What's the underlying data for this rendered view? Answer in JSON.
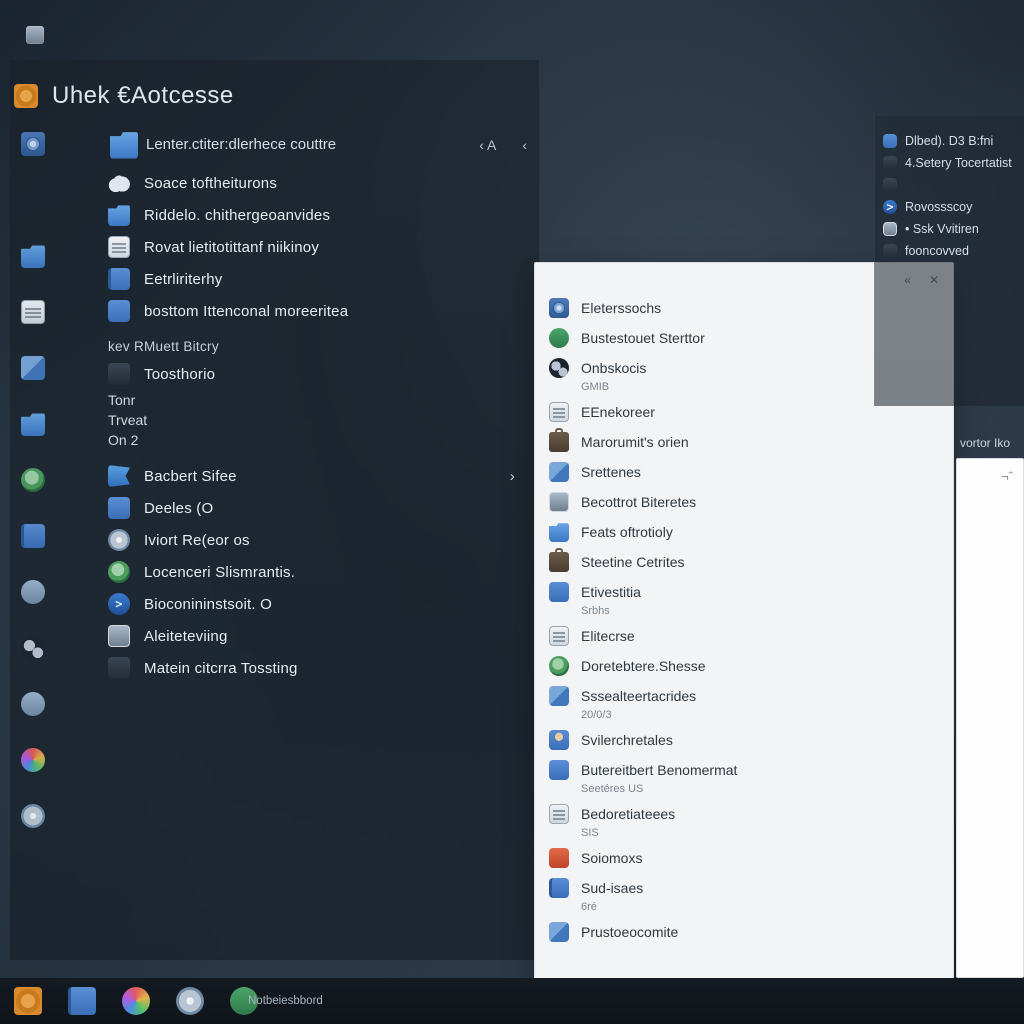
{
  "start": {
    "title": "Uhek €Aotcesse",
    "header": {
      "label": "Lenter.ctiter:dlerhece couttre",
      "ctrl1": "‹  A",
      "ctrl2": "‹"
    },
    "rail_icons": [
      "camera",
      "heart",
      "folder",
      "doc",
      "cube",
      "folder",
      "globe",
      "book",
      "link",
      "gears",
      "link",
      "paint",
      "disc"
    ],
    "items": [
      {
        "icon": "cloud",
        "label": "Soace toftheiturons"
      },
      {
        "icon": "folder",
        "label": "Riddelo. chithergeoanvides"
      },
      {
        "icon": "doc",
        "label": "Rovat lietitotittanf niikinoy"
      },
      {
        "icon": "book",
        "label": "Eetrliriterhy"
      },
      {
        "icon": "sq",
        "label": "bosttom Ittenconal moreeritea"
      }
    ],
    "section1": "kev RMuett Bitcry",
    "items2": [
      {
        "icon": "dark",
        "label": "Toosthorio"
      }
    ],
    "plain": [
      "Tonr",
      "Trveat",
      "On  2"
    ],
    "items3": [
      {
        "icon": "flag",
        "label": "Bacbert Sifee",
        "chev": "›"
      },
      {
        "icon": "sq",
        "label": "Deeles (O"
      },
      {
        "icon": "disc",
        "label": "Iviort Re(eor os"
      },
      {
        "icon": "globe",
        "label": "Locenceri Slismrantis."
      },
      {
        "icon": "shell",
        "label": "Bioconininstsoit.  O"
      },
      {
        "icon": "box",
        "label": "Aleiteteviing"
      },
      {
        "icon": "dark",
        "label": "Matein citcrra Tossting"
      }
    ]
  },
  "flyout": {
    "ctrl1": "«",
    "ctrl2": "✕",
    "items": [
      {
        "icon": "camera",
        "label": "Eleterssochs"
      },
      {
        "icon": "green",
        "label": "Bustestouet Sterttor"
      },
      {
        "icon": "gears",
        "label": "Onbskocis",
        "sub": "GMIB"
      },
      {
        "icon": "doc",
        "label": "EEnekoreer"
      },
      {
        "icon": "brief",
        "label": "Marorumit's orien"
      },
      {
        "icon": "cube",
        "label": "Srettenes"
      },
      {
        "icon": "box",
        "label": "Becottrot Biteretes"
      },
      {
        "icon": "folder",
        "label": "Feats oftrotioly"
      },
      {
        "icon": "brief",
        "label": "Steetine Cetrites"
      },
      {
        "icon": "sq",
        "label": "Etivestitia",
        "sub": "Srbhs"
      },
      {
        "icon": "doc",
        "label": "Elitecrse"
      },
      {
        "icon": "globe",
        "label": "Doretebtere.Shesse"
      },
      {
        "icon": "cube",
        "label": "Sssealteertacrides",
        "sub": "20/0/3"
      },
      {
        "icon": "user",
        "label": "Svilerchretales"
      },
      {
        "icon": "sq",
        "label": "Butereitbert Benomermat",
        "sub": "Seetéres  US"
      },
      {
        "icon": "doc",
        "label": "Bedoretiateees",
        "sub": "SIS"
      },
      {
        "icon": "red",
        "label": "Soiomoxs"
      },
      {
        "icon": "book",
        "label": "Sud-isaes",
        "sub": "6ré"
      },
      {
        "icon": "cube",
        "label": "Prustoeocomite"
      }
    ]
  },
  "bgwin": {
    "lines": [
      {
        "icon": "sq",
        "text": "Dlbed). D3 B:fni"
      },
      {
        "icon": "dark",
        "text": "4.Setery Tocertatist"
      },
      {
        "icon": "dark",
        "text": ""
      },
      {
        "icon": "shell",
        "text": "Rovossscoy"
      },
      {
        "icon": "box",
        "text": "•  Ssk Vvitiren"
      },
      {
        "icon": "dark",
        "text": "   fooncovved"
      }
    ],
    "lower": "vortor Iko"
  },
  "note_mark": "¬ˆ",
  "taskbar": {
    "items": [
      {
        "icon": "gear",
        "label": ""
      },
      {
        "icon": "book",
        "label": ""
      },
      {
        "icon": "paint",
        "label": ""
      },
      {
        "icon": "disc",
        "label": ""
      },
      {
        "icon": "green",
        "label": "Notbeiesbbord"
      }
    ]
  }
}
